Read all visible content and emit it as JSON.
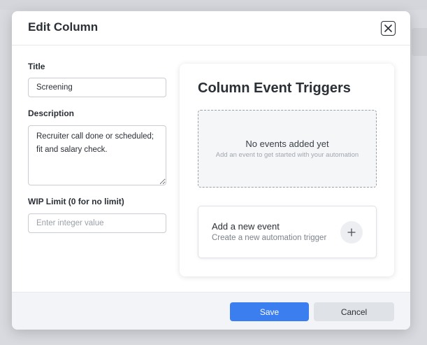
{
  "modal": {
    "title": "Edit Column",
    "close_icon": "close-x-icon"
  },
  "form": {
    "title_label": "Title",
    "title_value": "Screening",
    "description_label": "Description",
    "description_value": "Recruiter call done or scheduled; fit and salary check.",
    "wip_label": "WIP Limit (0 for no limit)",
    "wip_value": "",
    "wip_placeholder": "Enter integer value"
  },
  "triggers": {
    "title": "Column Event Triggers",
    "empty_title": "No events added yet",
    "empty_subtitle": "Add an event to get started with your automation",
    "add_title": "Add a new event",
    "add_subtitle": "Create a new automation trigger",
    "add_icon": "plus-icon"
  },
  "footer": {
    "save_label": "Save",
    "cancel_label": "Cancel"
  },
  "colors": {
    "primary": "#3b7ef0",
    "secondary": "#dfe2e6",
    "text": "#2b2f36"
  }
}
